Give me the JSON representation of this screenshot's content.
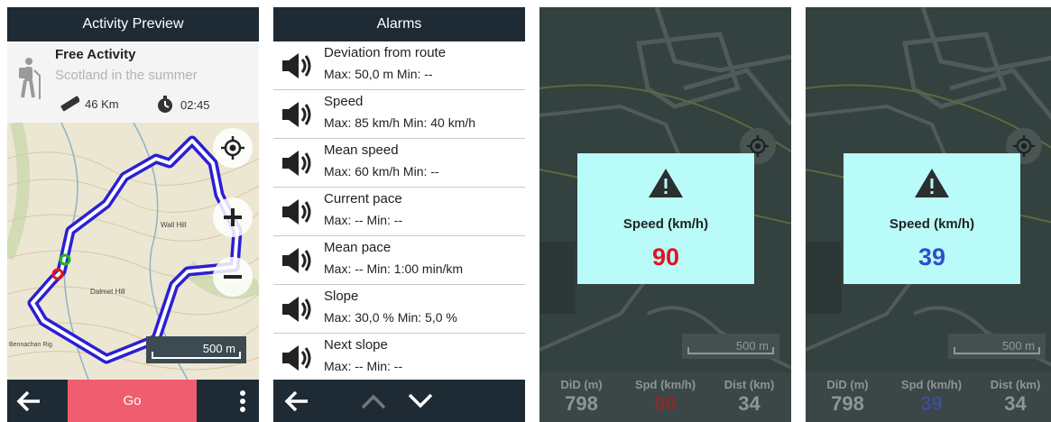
{
  "activity_preview": {
    "title": "Activity Preview",
    "name": "Free Activity",
    "subtitle": "Scotland in the summer",
    "distance": "46 Km",
    "duration": "02:45",
    "map_labels": [
      "Wall Hill",
      "Dalmet Hill",
      "Bennachan Rig"
    ],
    "scale": "500 m",
    "go_label": "Go"
  },
  "alarms": {
    "title": "Alarms",
    "items": [
      {
        "name": "Deviation from route",
        "value": "Max: 50,0 m  Min: --"
      },
      {
        "name": "Speed",
        "value": "Max: 85 km/h  Min: 40 km/h"
      },
      {
        "name": "Mean speed",
        "value": "Max: 60 km/h  Min: --"
      },
      {
        "name": "Current pace",
        "value": "Max: --  Min: --"
      },
      {
        "name": "Mean pace",
        "value": "Max: --  Min: 1:00 min/km"
      },
      {
        "name": "Slope",
        "value": "Max: 30,0 %  Min: 5,0 %"
      },
      {
        "name": "Next slope",
        "value": "Max: --  Min: --"
      }
    ]
  },
  "alert_high": {
    "label": "Speed (km/h)",
    "value": "90",
    "value_color": "#e0141e",
    "scale": "500 m",
    "fields": [
      {
        "label": "DiD (m)",
        "value": "798"
      },
      {
        "label": "Spd (km/h)",
        "value": "90"
      },
      {
        "label": "Dist (km)",
        "value": "34"
      }
    ]
  },
  "alert_low": {
    "label": "Speed (km/h)",
    "value": "39",
    "value_color": "#2f4fc9",
    "scale": "500 m",
    "fields": [
      {
        "label": "DiD (m)",
        "value": "798"
      },
      {
        "label": "Spd (km/h)",
        "value": "39"
      },
      {
        "label": "Dist (km)",
        "value": "34"
      }
    ]
  }
}
